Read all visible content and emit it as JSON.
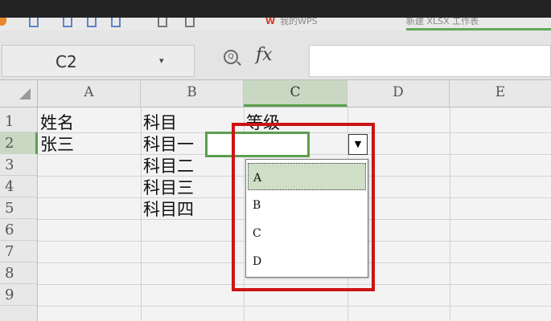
{
  "toolbar": {
    "tabs": [
      {
        "mark": "W",
        "label": "我的WPS"
      },
      {
        "mark": "",
        "label": "新建 XLSX 工作表"
      }
    ]
  },
  "formula_bar": {
    "name_box": "C2",
    "name_box_arrow": "▾",
    "zoom_glyph": "Q",
    "fx_label": "fx",
    "formula_value": ""
  },
  "sheet": {
    "columns": [
      "A",
      "B",
      "C",
      "D",
      "E"
    ],
    "active_column": "C",
    "rows": [
      "1",
      "2",
      "3",
      "4",
      "5",
      "6",
      "7",
      "8",
      "9"
    ],
    "active_row": "2",
    "cells": {
      "A1": "姓名",
      "B1": "科目",
      "C1": "等级",
      "A2": "张三",
      "B2": "科目一",
      "B3": "科目二",
      "B4": "科目三",
      "B5": "科目四"
    }
  },
  "dropdown": {
    "arrow": "▼",
    "options": [
      "A",
      "B",
      "C",
      "D"
    ],
    "selected": "A"
  },
  "colors": {
    "highlight": "#cc1414",
    "active_green": "#5c9e4d",
    "option_highlight": "#cfdfc7"
  },
  "icons": [
    "corner-select-icon",
    "dropdown-arrow-icon",
    "zoom-icon",
    "fx-icon"
  ]
}
